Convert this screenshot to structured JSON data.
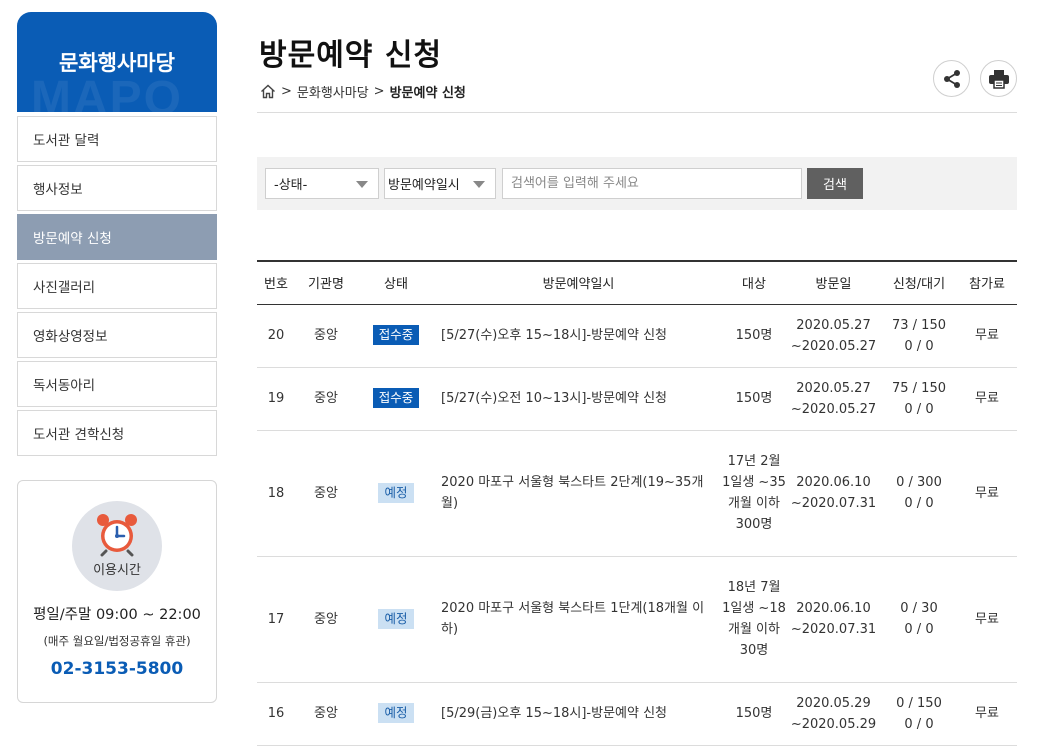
{
  "sidebar": {
    "title": "문화행사마당",
    "watermark": "MAPO",
    "items": [
      {
        "label": "도서관 달력",
        "active": false
      },
      {
        "label": "행사정보",
        "active": false
      },
      {
        "label": "방문예약 신청",
        "active": true
      },
      {
        "label": "사진갤러리",
        "active": false
      },
      {
        "label": "영화상영정보",
        "active": false
      },
      {
        "label": "독서동아리",
        "active": false
      },
      {
        "label": "도서관 견학신청",
        "active": false
      }
    ],
    "hours": {
      "icon_label": "이용시간",
      "time": "평일/주말 09:00 ~ 22:00",
      "note": "(매주 월요일/법정공휴일 휴관)",
      "phone": "02-3153-5800"
    }
  },
  "header": {
    "title": "방문예약 신청",
    "breadcrumb": [
      ">",
      "문화행사마당",
      ">",
      "방문예약 신청"
    ]
  },
  "search": {
    "status_select": "-상태-",
    "field_select": "방문예약일시",
    "placeholder": "검색어를 입력해 주세요",
    "button": "검색"
  },
  "table": {
    "headers": [
      "번호",
      "기관명",
      "상태",
      "방문예약일시",
      "대상",
      "방문일",
      "신청/대기",
      "참가료"
    ],
    "rows": [
      {
        "no": "20",
        "org": "중앙",
        "status": "접수중",
        "status_type": "open",
        "subject": "[5/27(수)오후 15~18시]-방문예약 신청",
        "target": "150명",
        "date_from": "2020.05.27",
        "date_to": "~2020.05.27",
        "apply": "73 / 150",
        "wait": "0 / 0",
        "fee": "무료"
      },
      {
        "no": "19",
        "org": "중앙",
        "status": "접수중",
        "status_type": "open",
        "subject": "[5/27(수)오전 10~13시]-방문예약 신청",
        "target": "150명",
        "date_from": "2020.05.27",
        "date_to": "~2020.05.27",
        "apply": "75 / 150",
        "wait": "0 / 0",
        "fee": "무료"
      },
      {
        "no": "18",
        "org": "중앙",
        "status": "예정",
        "status_type": "plan",
        "subject": "2020 마포구 서울형 북스타트 2단계(19~35개월)",
        "target": "17년 2월 1일생 ~35개월 이하 300명",
        "date_from": "2020.06.10",
        "date_to": "~2020.07.31",
        "apply": "0 / 300",
        "wait": "0 / 0",
        "fee": "무료"
      },
      {
        "no": "17",
        "org": "중앙",
        "status": "예정",
        "status_type": "plan",
        "subject": "2020 마포구 서울형 북스타트 1단계(18개월 이하)",
        "target": "18년 7월 1일생 ~18개월 이하 30명",
        "date_from": "2020.06.10",
        "date_to": "~2020.07.31",
        "apply": "0 / 30",
        "wait": "0 / 0",
        "fee": "무료"
      },
      {
        "no": "16",
        "org": "중앙",
        "status": "예정",
        "status_type": "plan",
        "subject": "[5/29(금)오후 15~18시]-방문예약 신청",
        "target": "150명",
        "date_from": "2020.05.29",
        "date_to": "~2020.05.29",
        "apply": "0 / 150",
        "wait": "0 / 0",
        "fee": "무료"
      }
    ]
  },
  "colors": {
    "brand": "#0a5cb5",
    "active_menu": "#8d9db2",
    "badge_plan_bg": "#cbe0f3"
  }
}
